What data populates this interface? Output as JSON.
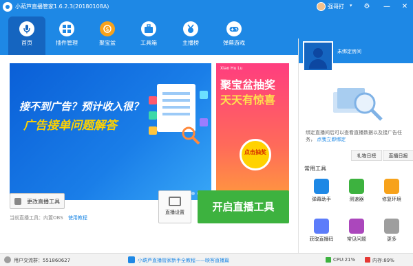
{
  "window": {
    "title": "小葫芦直播管家1.6.2.3(20180108A)",
    "user_name": "强哥打",
    "buttons": {
      "settings": "⚙",
      "minimize": "—",
      "close": "✕",
      "caret": "▾"
    }
  },
  "nav": {
    "items": [
      {
        "label": "首页",
        "icon": "microphone-icon",
        "active": true
      },
      {
        "label": "插件管理",
        "icon": "plugin-grid-icon",
        "active": false
      },
      {
        "label": "聚宝盆",
        "icon": "treasure-bowl-icon",
        "active": false
      },
      {
        "label": "工具箱",
        "icon": "toolbox-icon",
        "active": false
      },
      {
        "label": "主播榜",
        "icon": "ranking-medal-icon",
        "active": false
      },
      {
        "label": "弹幕游戏",
        "icon": "gamepad-icon",
        "active": false
      }
    ]
  },
  "banner_main": {
    "line1": "接不到广告？预计收入很？",
    "line2": "广告接单问题解答",
    "slide_count": 4,
    "active_slide": 1
  },
  "banner_side": {
    "sub": "Xiao Hu Lu",
    "line1": "聚宝盆抽奖",
    "line2": "天天有惊喜",
    "button": "点击抽奖"
  },
  "controls": {
    "change_tool": "更改直播工具",
    "current_tool": "当前直播工具：内置OBS",
    "tutorial_link": "使用教程",
    "live_settings": "直播设置",
    "start_live": "开启直播工具"
  },
  "right_panel": {
    "room_status": "未绑定房间",
    "desc": "绑定直播间后可以查看直播数据以及接广告任务，",
    "bind_link": "点我立即绑定",
    "tabs": [
      "礼物日榜",
      "直播日报"
    ],
    "tools_title": "常用工具",
    "tools": [
      {
        "label": "弹幕助手",
        "icon": "danmaku-assistant-icon",
        "color": "#1e88e5"
      },
      {
        "label": "测速器",
        "icon": "speed-test-icon",
        "color": "#3db23f"
      },
      {
        "label": "修复环境",
        "icon": "repair-wrench-icon",
        "color": "#f7a21b"
      },
      {
        "label": "获取直播码",
        "icon": "stream-code-icon",
        "color": "#5c7cfa"
      },
      {
        "label": "常见问题",
        "icon": "faq-qa-icon",
        "color": "#ab47bc"
      },
      {
        "label": "更多",
        "icon": "more-dots-icon",
        "color": "#9e9e9e"
      }
    ]
  },
  "status_bar": {
    "group": "用户交流群：551860627",
    "news": "小葫芦直播管家新手全教程——映客直播篇",
    "cpu": "CPU:21%",
    "memory": "内存:89%"
  }
}
